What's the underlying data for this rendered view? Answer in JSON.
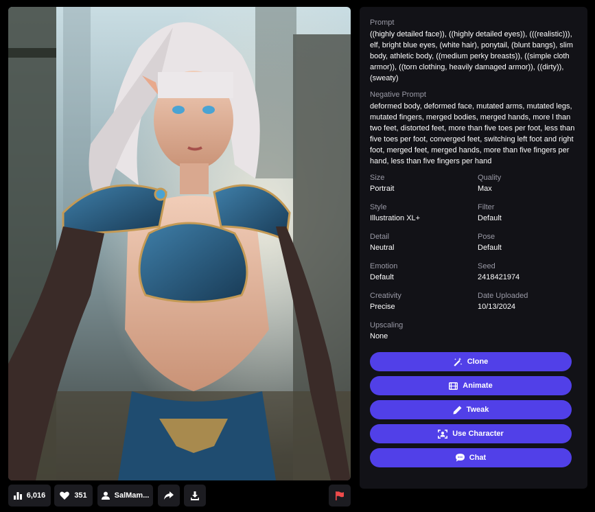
{
  "image": {
    "alt": "elf warrior in damaged blue armor"
  },
  "bottom_bar": {
    "views_count": "6,016",
    "likes_count": "351",
    "user_name": "SalMam..."
  },
  "panel": {
    "prompt_label": "Prompt",
    "prompt_text": "((highly detailed face)), ((highly detailed eyes)), (((realistic))), elf, bright blue eyes, (white hair), ponytail, (blunt bangs), slim body, athletic body, ((medium perky breasts)), ((simple cloth armor)), ((torn clothing, heavily damaged armor)), ((dirty)), (sweaty)",
    "negative_label": "Negative Prompt",
    "negative_text": "deformed body, deformed face, mutated arms, mutated legs, mutated fingers, merged bodies, merged hands, more l than two feet, distorted feet, more than five toes per foot, less than five toes per foot, converged feet, switching left foot and right foot, merged feet, merged hands, more than five fingers per hand, less than five fingers per hand",
    "fields": [
      {
        "label": "Size",
        "value": "Portrait"
      },
      {
        "label": "Quality",
        "value": "Max"
      },
      {
        "label": "Style",
        "value": "Illustration XL+"
      },
      {
        "label": "Filter",
        "value": "Default"
      },
      {
        "label": "Detail",
        "value": "Neutral"
      },
      {
        "label": "Pose",
        "value": "Default"
      },
      {
        "label": "Emotion",
        "value": "Default"
      },
      {
        "label": "Seed",
        "value": "2418421974"
      },
      {
        "label": "Creativity",
        "value": "Precise"
      },
      {
        "label": "Date Uploaded",
        "value": "10/13/2024"
      },
      {
        "label": "Upscaling",
        "value": "None"
      }
    ],
    "actions": {
      "clone": "Clone",
      "animate": "Animate",
      "tweak": "Tweak",
      "use_character": "Use Character",
      "chat": "Chat"
    }
  },
  "colors": {
    "accent": "#5140e8",
    "panel_bg": "#121217",
    "button_bg": "#1c1c21",
    "flag": "#f04b4b"
  }
}
